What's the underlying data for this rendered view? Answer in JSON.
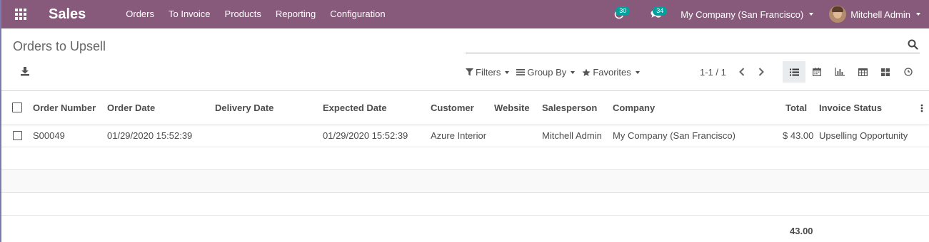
{
  "navbar": {
    "app_title": "Sales",
    "menu": [
      "Orders",
      "To Invoice",
      "Products",
      "Reporting",
      "Configuration"
    ],
    "activity_count": "30",
    "message_count": "34",
    "company": "My Company (San Francisco)",
    "user": "Mitchell Admin"
  },
  "control_panel": {
    "breadcrumb": "Orders to Upsell",
    "search_placeholder": "",
    "filters_label": "Filters",
    "group_by_label": "Group By",
    "favorites_label": "Favorites",
    "pager": "1-1 / 1"
  },
  "table": {
    "columns": [
      "Order Number",
      "Order Date",
      "Delivery Date",
      "Expected Date",
      "Customer",
      "Website",
      "Salesperson",
      "Company",
      "Total",
      "Invoice Status"
    ],
    "rows": [
      {
        "order_number": "S00049",
        "order_date": "01/29/2020 15:52:39",
        "delivery_date": "",
        "expected_date": "01/29/2020 15:52:39",
        "customer": "Azure Interior",
        "website": "",
        "salesperson": "Mitchell Admin",
        "company": "My Company (San Francisco)",
        "total": "$ 43.00",
        "invoice_status": "Upselling Opportunity"
      }
    ],
    "footer_total": "43.00"
  },
  "colors": {
    "brand": "#875a7b",
    "badge": "#00a09d"
  }
}
